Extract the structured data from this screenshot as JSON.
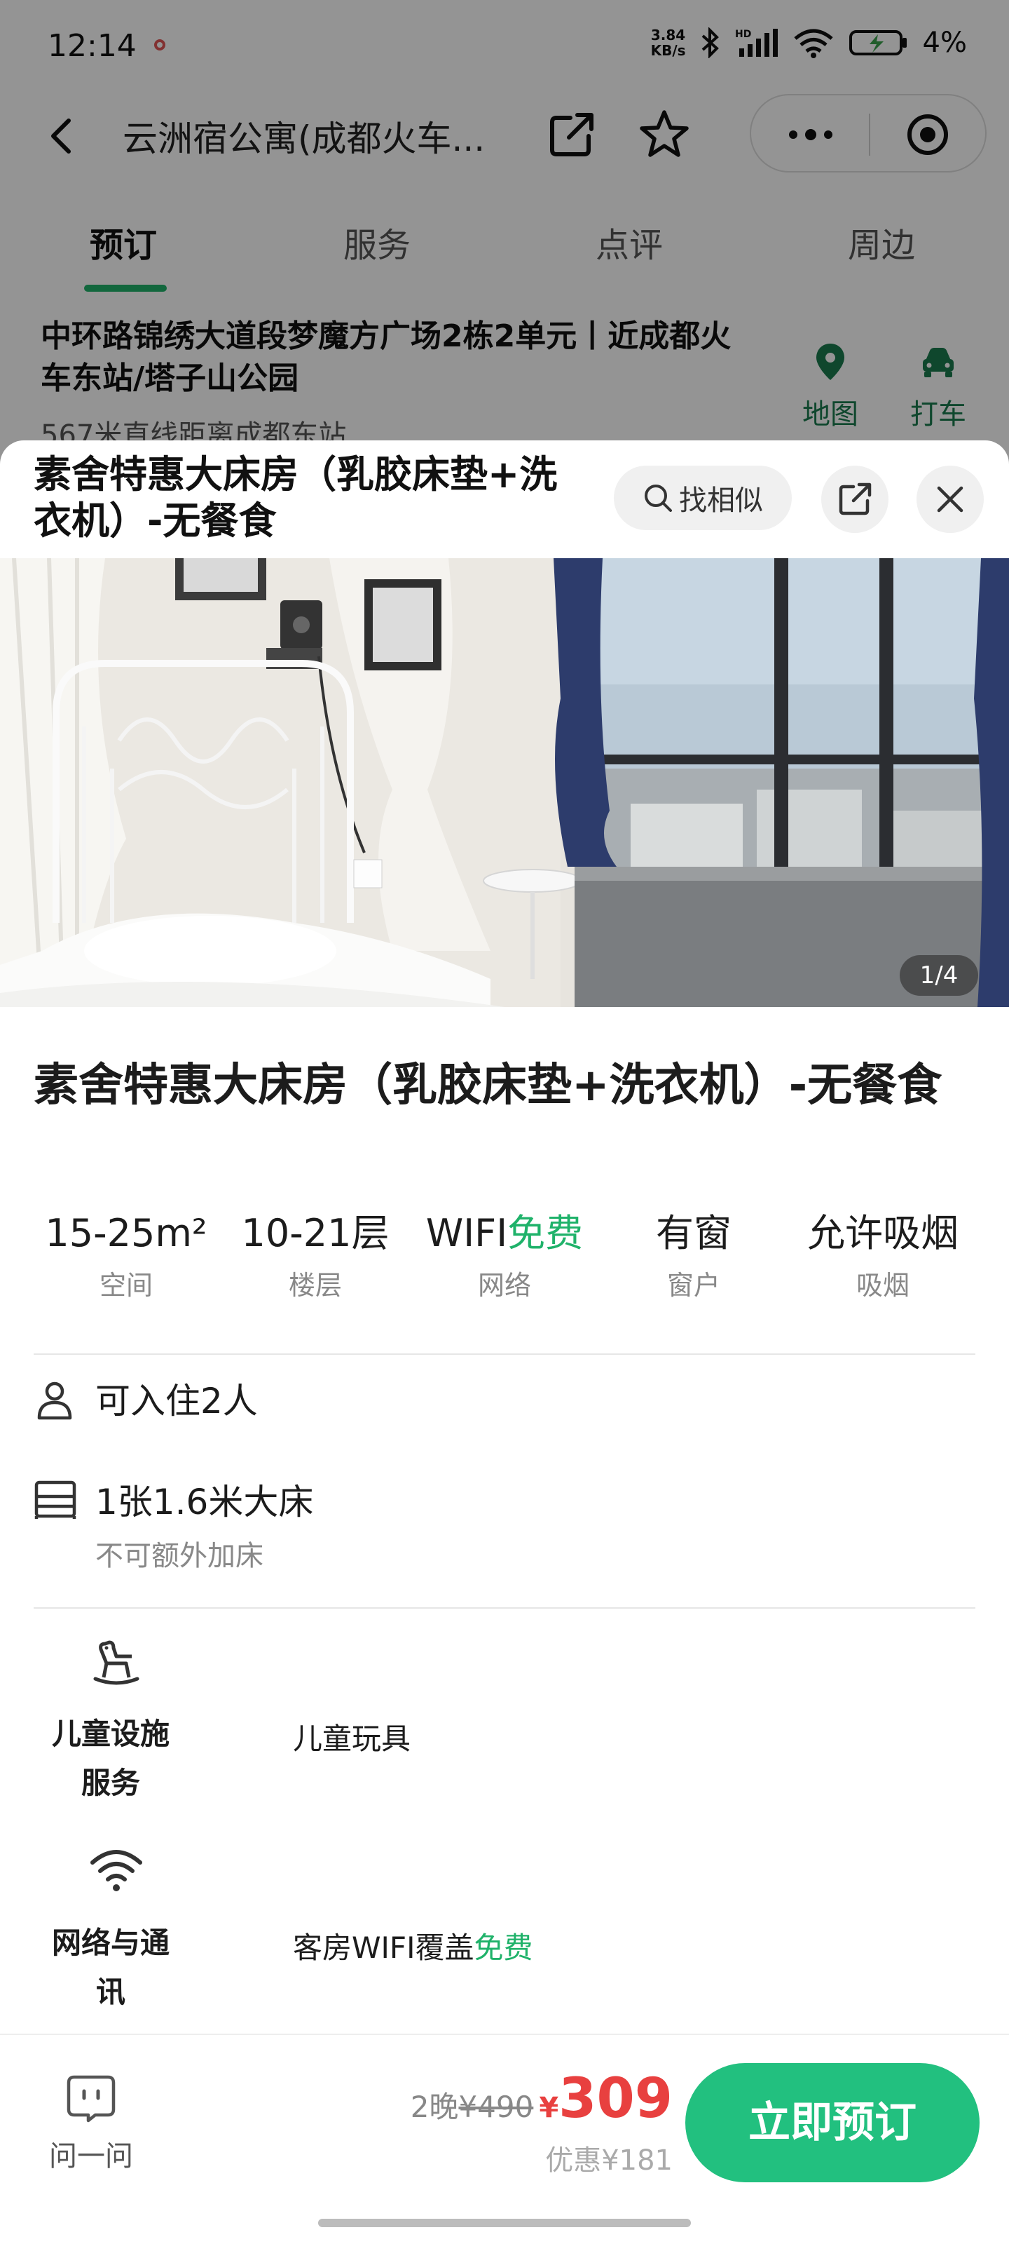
{
  "status_bar": {
    "time": "12:14",
    "net_speed_value": "3.84",
    "net_speed_unit": "KB/s",
    "battery": "4%"
  },
  "nav": {
    "title": "云洲宿公寓(成都火车..."
  },
  "tabs": [
    {
      "label": "预订",
      "active": true
    },
    {
      "label": "服务",
      "active": false
    },
    {
      "label": "点评",
      "active": false
    },
    {
      "label": "周边",
      "active": false
    }
  ],
  "location": {
    "address": "中环路锦绣大道段梦魔方广场2栋2单元丨近成都火车东站/塔子山公园",
    "distance": "567米直线距离成都东站",
    "map_label": "地图",
    "taxi_label": "打车"
  },
  "sheet": {
    "header_title": "素舍特惠大床房（乳胶床垫+洗衣机）-无餐食",
    "similar_label": "找相似",
    "photo_counter": "1/4",
    "room_name": "素舍特惠大床房（乳胶床垫+洗衣机）-无餐食",
    "specs": [
      {
        "value": "15-25m²",
        "label": "空间"
      },
      {
        "value": "10-21层",
        "label": "楼层"
      },
      {
        "value": "WIFI",
        "value_accent": "免费",
        "label": "网络"
      },
      {
        "value": "有窗",
        "label": "窗户"
      },
      {
        "value": "允许吸烟",
        "label": "吸烟"
      }
    ],
    "occupancy": "可入住2人",
    "bed": "1张1.6米大床",
    "extra_bed": "不可额外加床",
    "facilities": [
      {
        "category": [
          "儿童设施",
          "服务"
        ],
        "value": "儿童玩具",
        "icon": "rocking-horse-icon"
      },
      {
        "category": [
          "网络与通",
          "讯"
        ],
        "value": "客房WIFI覆盖",
        "value_accent": "免费",
        "icon": "wifi-icon"
      }
    ]
  },
  "bottom_bar": {
    "ask_label": "问一问",
    "nights": "2晚",
    "original_price": "¥490",
    "currency": "¥",
    "price": "309",
    "discount": "优惠¥181",
    "book_label": "立即预订"
  },
  "colors": {
    "accent_green": "#1fb26a",
    "book_button": "#22c07f",
    "price_red": "#e8403f"
  }
}
